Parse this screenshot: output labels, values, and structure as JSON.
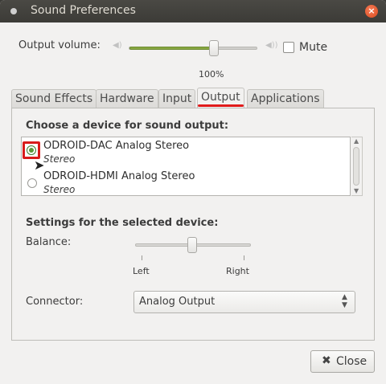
{
  "window": {
    "title": "Sound Preferences"
  },
  "volume": {
    "label": "Output volume:",
    "percent_text": "100%",
    "level_fraction": 0.66,
    "mute_label": "Mute",
    "mute_checked": false
  },
  "tabs": [
    {
      "label": "Sound Effects"
    },
    {
      "label": "Hardware"
    },
    {
      "label": "Input"
    },
    {
      "label": "Output",
      "active": true
    },
    {
      "label": "Applications"
    }
  ],
  "output": {
    "choose_label": "Choose a device for sound output:",
    "devices": [
      {
        "name": "ODROID-DAC Analog Stereo",
        "profile": "Stereo",
        "selected": true
      },
      {
        "name": "ODROID-HDMI Analog Stereo",
        "profile": "Stereo",
        "selected": false
      }
    ],
    "settings_label": "Settings for the selected device:",
    "balance_label": "Balance:",
    "balance_left": "Left",
    "balance_right": "Right",
    "balance_value": 0.5,
    "connector_label": "Connector:",
    "connector_value": "Analog Output"
  },
  "footer": {
    "close_label": "Close"
  },
  "colors": {
    "accent": "#88a741",
    "highlight": "#e01b1b",
    "titlebar": "#3c3b37"
  }
}
